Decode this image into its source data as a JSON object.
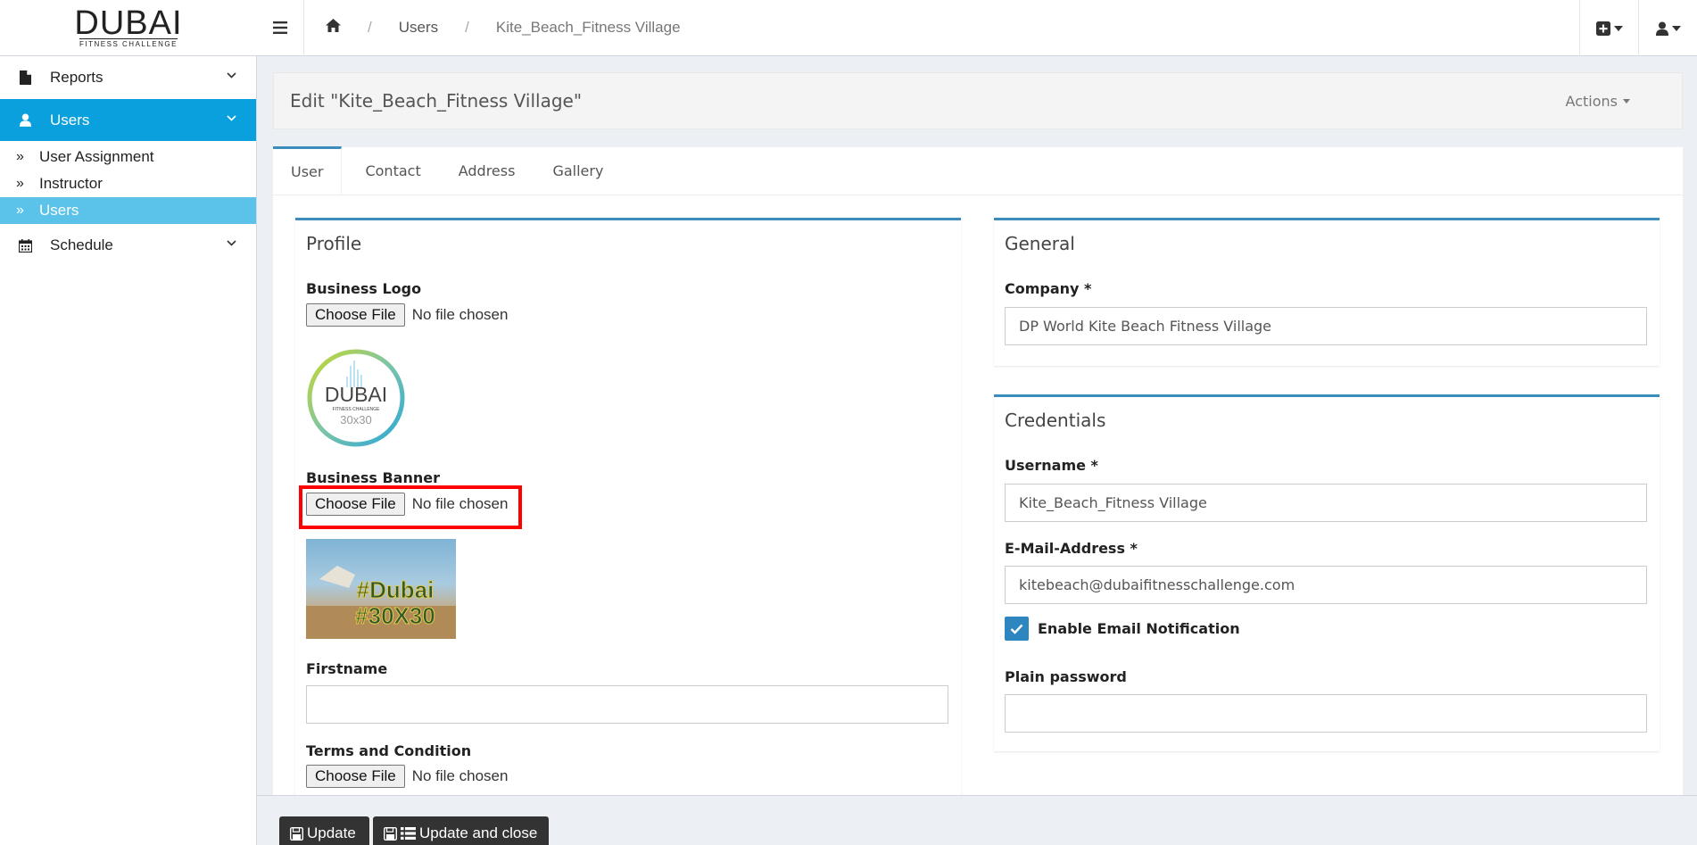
{
  "brand": {
    "main": "DUBAI",
    "sub": "FITNESS CHALLENGE"
  },
  "breadcrumb": {
    "home_icon": "home-icon",
    "users": "Users",
    "sep": "/",
    "current": "Kite_Beach_Fitness Village"
  },
  "topbar": {
    "add_icon": "plus-square-icon",
    "user_icon": "user-icon"
  },
  "sidebar": {
    "reports": "Reports",
    "users": "Users",
    "sub": [
      "User Assignment",
      "Instructor",
      "Users"
    ],
    "sub_marker": "»",
    "schedule": "Schedule"
  },
  "page": {
    "title": "Edit \"Kite_Beach_Fitness Village\"",
    "actions": "Actions"
  },
  "tabs": [
    "User",
    "Contact",
    "Address",
    "Gallery"
  ],
  "profile": {
    "title": "Profile",
    "business_logo": "Business Logo",
    "business_banner": "Business Banner",
    "firstname": "Firstname",
    "firstname_value": "",
    "terms": "Terms and Condition",
    "choose_file": "Choose File",
    "no_file": "No file chosen",
    "logo_text": "DUBAI",
    "logo_sub": "FITNESS CHALLENGE",
    "logo_num": "30x30",
    "banner_text_1": "#Dubai",
    "banner_text_2": "#30X30"
  },
  "general": {
    "title": "General",
    "company_label": "Company *",
    "company_value": "DP World Kite Beach Fitness Village"
  },
  "credentials": {
    "title": "Credentials",
    "username_label": "Username *",
    "username_value": "Kite_Beach_Fitness Village",
    "email_label": "E-Mail-Address *",
    "email_value": "kitebeach@dubaifitnesschallenge.com",
    "notify_label": "Enable Email Notification",
    "notify_checked": true,
    "password_label": "Plain password",
    "password_value": ""
  },
  "footer": {
    "update": "Update",
    "update_close": "Update and close"
  },
  "colors": {
    "accent": "#0aa0dd",
    "sub_active": "#5bc3ea",
    "box_border": "#3c8dbc",
    "highlight": "#ff0000"
  }
}
